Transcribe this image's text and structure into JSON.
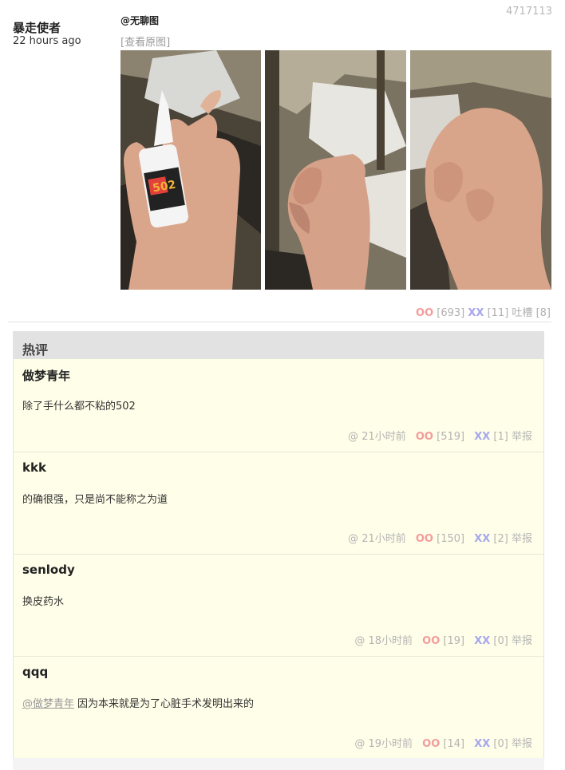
{
  "post": {
    "id": "4717113",
    "author": "暴走使者",
    "time": "22 hours ago",
    "title": "@无聊图",
    "view_original": "[查看原图]",
    "votes": {
      "oo_label": "OO",
      "oo_count": "[693]",
      "xx_label": "XX",
      "xx_count": "[11]",
      "tucao_label": "吐槽",
      "tucao_count": "[8]"
    },
    "photos": [
      {
        "desc": "hand holding 502 glue bottle",
        "bottle_label": "502"
      },
      {
        "desc": "fist"
      },
      {
        "desc": "fist close-up"
      }
    ]
  },
  "hot": {
    "header": "热评",
    "comments": [
      {
        "author": "做梦青年",
        "mention": "",
        "text": "除了手什么都不粘的502",
        "time": "21小时前",
        "oo": "[519]",
        "xx": "[1]"
      },
      {
        "author": "kkk",
        "mention": "",
        "text": "的确很强，只是尚不能称之为道",
        "time": "21小时前",
        "oo": "[150]",
        "xx": "[2]"
      },
      {
        "author": "senlody",
        "mention": "",
        "text": "换皮药水",
        "time": "18小时前",
        "oo": "[19]",
        "xx": "[0]"
      },
      {
        "author": "qqq",
        "mention": "@做梦青年",
        "text": "因为本来就是为了心脏手术发明出来的",
        "time": "19小时前",
        "oo": "[14]",
        "xx": "[0]"
      }
    ],
    "labels": {
      "at": "@",
      "oo": "OO",
      "xx": "XX",
      "report": "举报"
    }
  },
  "colors": {
    "oo": "#f49b9b",
    "xx": "#a6a6ee",
    "comment_bg": "#fefee9",
    "header_bg": "#e2e2e2"
  }
}
